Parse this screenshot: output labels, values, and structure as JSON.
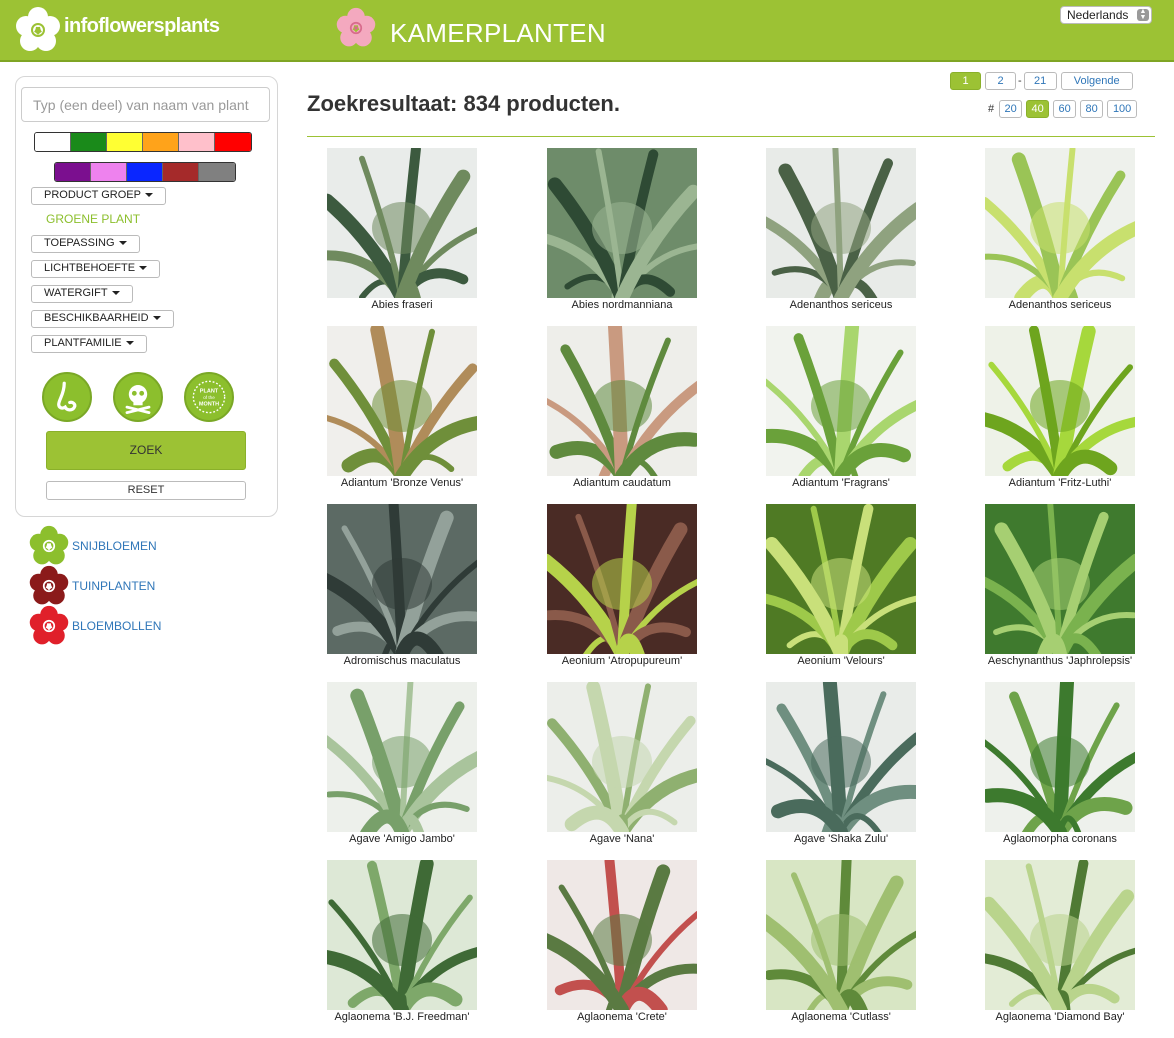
{
  "header": {
    "logo_text": "infoflowersplants",
    "section_title": "KAMERPLANTEN",
    "language": "Nederlands"
  },
  "sidebar": {
    "search_placeholder": "Typ (een deel) van naam van plant",
    "colors_row1": [
      "#ffffff",
      "#1a8a1a",
      "#ffff33",
      "#ffa31a",
      "#ffc0cb",
      "#ff0000"
    ],
    "colors_row2": [
      "#7b0f8f",
      "#ee82ee",
      "#0a26ff",
      "#a52a2a",
      "#808080"
    ],
    "filters": {
      "product_groep": "PRODUCT GROEP",
      "product_groep_selected": "GROENE PLANT",
      "toepassing": "TOEPASSING",
      "lichtbehoefte": "LICHTBEHOEFTE",
      "watergift": "WATERGIFT",
      "beschikbaarheid": "BESCHIKBAARHEID",
      "plantfamilie": "PLANTFAMILIE"
    },
    "icons": [
      "nose-icon",
      "skull-crossbones-icon",
      "plant-of-the-month-icon"
    ],
    "plant_of_month_text": [
      "PLANT",
      "of the",
      "MONTH"
    ],
    "search_button": "ZOEK",
    "reset_button": "RESET"
  },
  "categories": [
    {
      "label": "SNIJBLOEMEN",
      "color": "#8cbf2d"
    },
    {
      "label": "TUINPLANTEN",
      "color": "#8b1a1a"
    },
    {
      "label": "BLOEMBOLLEN",
      "color": "#e0202a"
    }
  ],
  "results": {
    "title": "Zoekresultaat: 834 producten.",
    "pages": [
      "1",
      "2",
      "-",
      "21"
    ],
    "next_label": "Volgende",
    "per_page_label": "#",
    "per_page_options": [
      "20",
      "40",
      "60",
      "80",
      "100"
    ],
    "per_page_selected": "40",
    "current_page": "1"
  },
  "products": [
    {
      "name": "Abies fraseri",
      "palette": [
        "#e9ecea",
        "#3c5a3f",
        "#6f8a5e"
      ]
    },
    {
      "name": "Abies nordmanniana",
      "palette": [
        "#6e8c6a",
        "#2e4a34",
        "#9bb592"
      ]
    },
    {
      "name": "Adenanthos sericeus",
      "palette": [
        "#e8ebe8",
        "#4a6146",
        "#8fa27f"
      ]
    },
    {
      "name": "Adenanthos sericeus",
      "palette": [
        "#eef1ec",
        "#9ac456",
        "#c8e06e"
      ]
    },
    {
      "name": "Adiantum 'Bronze Venus'",
      "palette": [
        "#f0efec",
        "#b08c5a",
        "#6f8f3a"
      ]
    },
    {
      "name": "Adiantum caudatum",
      "palette": [
        "#eeeeea",
        "#c99a80",
        "#5f8a3e"
      ]
    },
    {
      "name": "Adiantum 'Fragrans'",
      "palette": [
        "#f1f3ee",
        "#a9d66e",
        "#6aa13a"
      ]
    },
    {
      "name": "Adiantum 'Fritz-Luthi'",
      "palette": [
        "#eef2e8",
        "#a6d83c",
        "#6ea51e"
      ]
    },
    {
      "name": "Adromischus maculatus",
      "palette": [
        "#5c6a64",
        "#93a19a",
        "#2f3b37"
      ]
    },
    {
      "name": "Aeonium 'Atropupureum'",
      "palette": [
        "#4a2b25",
        "#8a5a4a",
        "#b6d24a"
      ]
    },
    {
      "name": "Aeonium 'Velours'",
      "palette": [
        "#4f7a24",
        "#9ec94a",
        "#c9e07a"
      ]
    },
    {
      "name": "Aeschynanthus 'Japhrolepsis'",
      "palette": [
        "#3f7a2e",
        "#7ab24e",
        "#a6cf72"
      ]
    },
    {
      "name": "Agave 'Amigo Jambo'",
      "palette": [
        "#edf0eb",
        "#a9c49c",
        "#78a06a"
      ]
    },
    {
      "name": "Agave 'Nana'",
      "palette": [
        "#eceeea",
        "#8fb070",
        "#c5d7ae"
      ]
    },
    {
      "name": "Agave 'Shaka Zulu'",
      "palette": [
        "#e9ece9",
        "#6f8f80",
        "#4a6b5c"
      ]
    },
    {
      "name": "Aglaomorpha coronans",
      "palette": [
        "#eef1ec",
        "#6ea34a",
        "#3d7a2e"
      ]
    },
    {
      "name": "Aglaonema 'B.J. Freedman'",
      "palette": [
        "#dde8d6",
        "#7ea86a",
        "#3f6a36"
      ]
    },
    {
      "name": "Aglaonema 'Crete'",
      "palette": [
        "#efe8e6",
        "#c2504e",
        "#5a7a42"
      ]
    },
    {
      "name": "Aglaonema 'Cutlass'",
      "palette": [
        "#d8e6c4",
        "#5f8a3a",
        "#9fbf70"
      ]
    },
    {
      "name": "Aglaonema 'Diamond Bay'",
      "palette": [
        "#e3ecd6",
        "#4f7a34",
        "#b9d48c"
      ]
    }
  ]
}
